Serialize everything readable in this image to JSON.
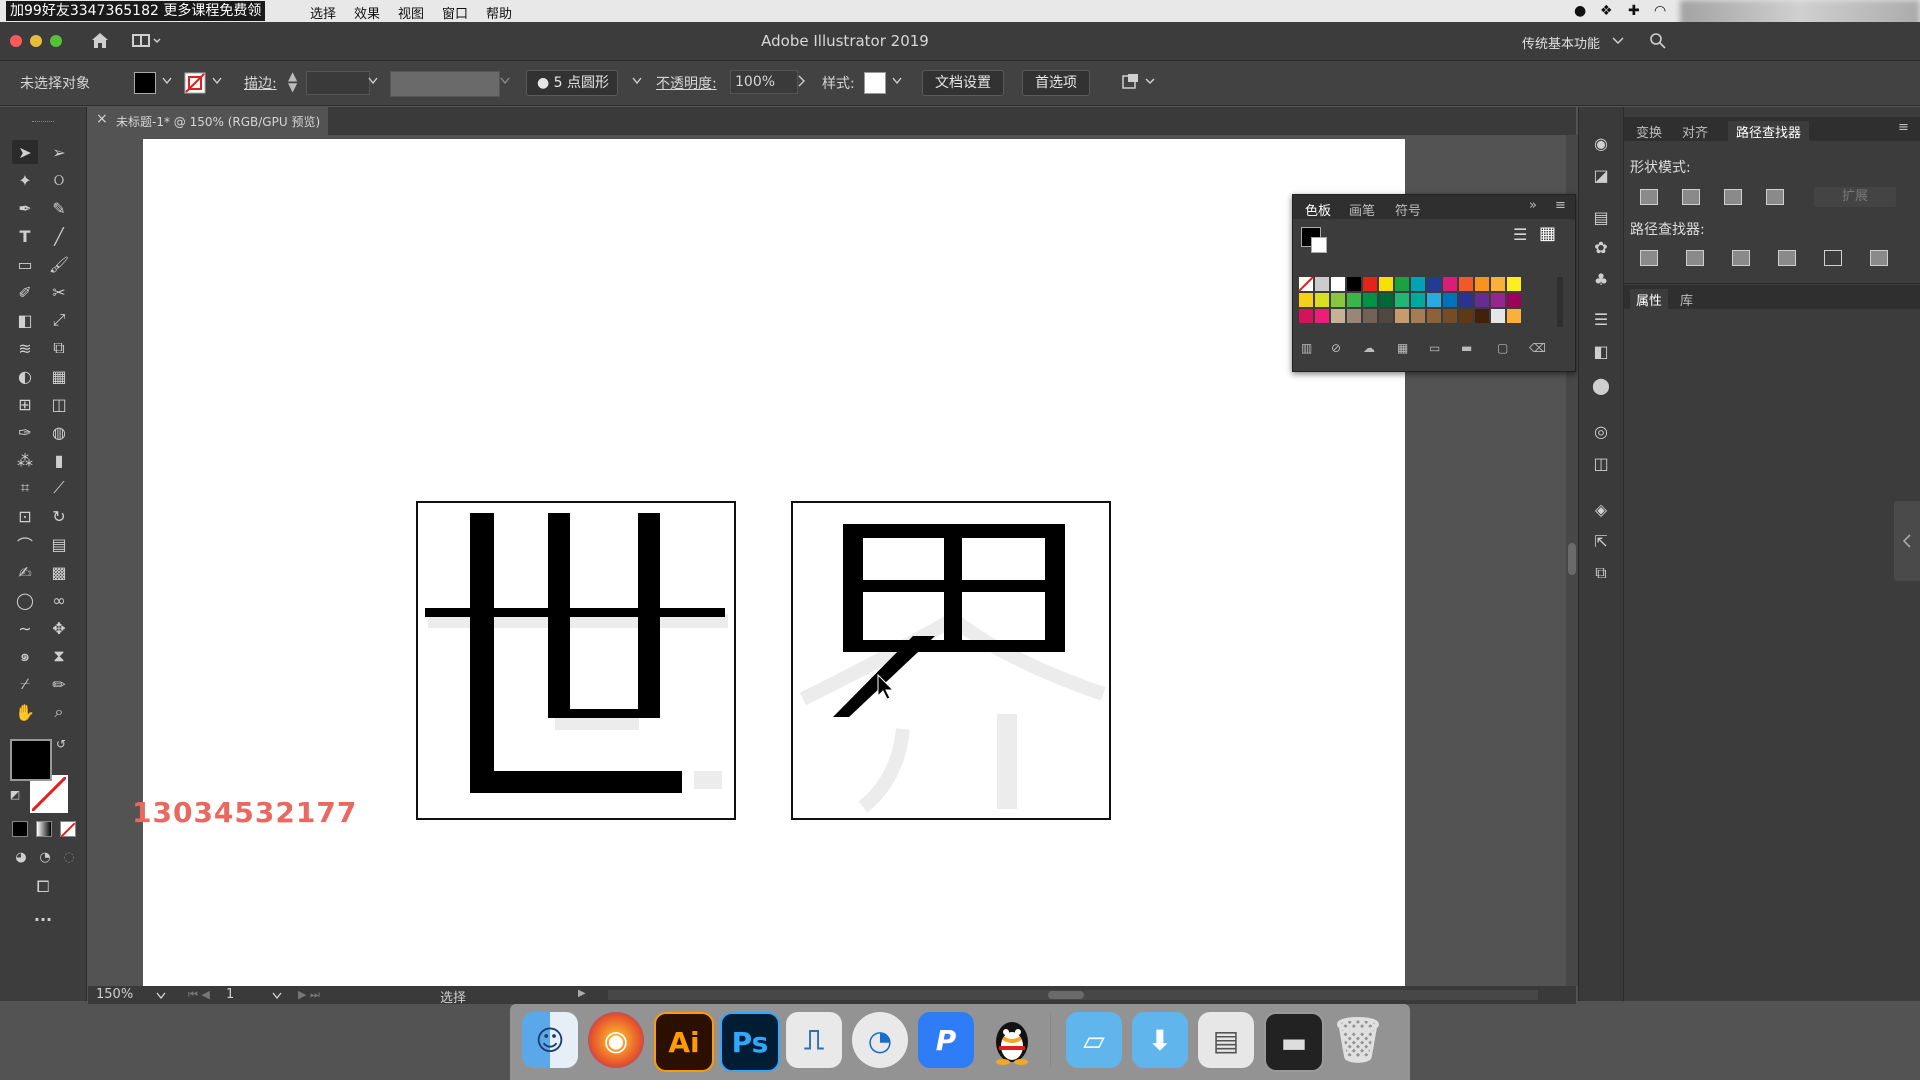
{
  "menubar": {
    "overlay_text": "加99好友3347365182 更多课程免费领",
    "items": [
      "选择",
      "效果",
      "视图",
      "窗口",
      "帮助"
    ]
  },
  "window": {
    "title": "Adobe Illustrator 2019",
    "workspace": "传统基本功能"
  },
  "control_bar": {
    "selection": "未选择对象",
    "stroke_label": "描边:",
    "brush": "5 点圆形",
    "opacity_label": "不透明度:",
    "opacity_value": "100%",
    "style_label": "样式:",
    "doc_setup": "文档设置",
    "prefs": "首选项"
  },
  "document_tab": {
    "close": "×",
    "label": "未标题-1* @ 150% (RGB/GPU 预览)"
  },
  "artboard": {
    "char1": "世",
    "char2": "界",
    "watermark": "13034532177"
  },
  "swatches_panel": {
    "tabs": [
      "色板",
      "画笔",
      "符号"
    ],
    "expand": "»"
  },
  "right_panel": {
    "top_tabs": [
      "变换",
      "对齐",
      "路径查找器"
    ],
    "shape_modes_label": "形状模式:",
    "expand_button": "扩展",
    "pathfinder_label": "路径查找器:",
    "bottom_tabs": [
      "属性",
      "库"
    ]
  },
  "status_bar": {
    "zoom": "150%",
    "page": "1",
    "mode": "选择"
  },
  "dock": {
    "ai": "Ai",
    "ps": "Ps",
    "p": "P"
  },
  "colors": {
    "accent_red": "#e9685f",
    "panel_bg": "#3c3c3c"
  }
}
